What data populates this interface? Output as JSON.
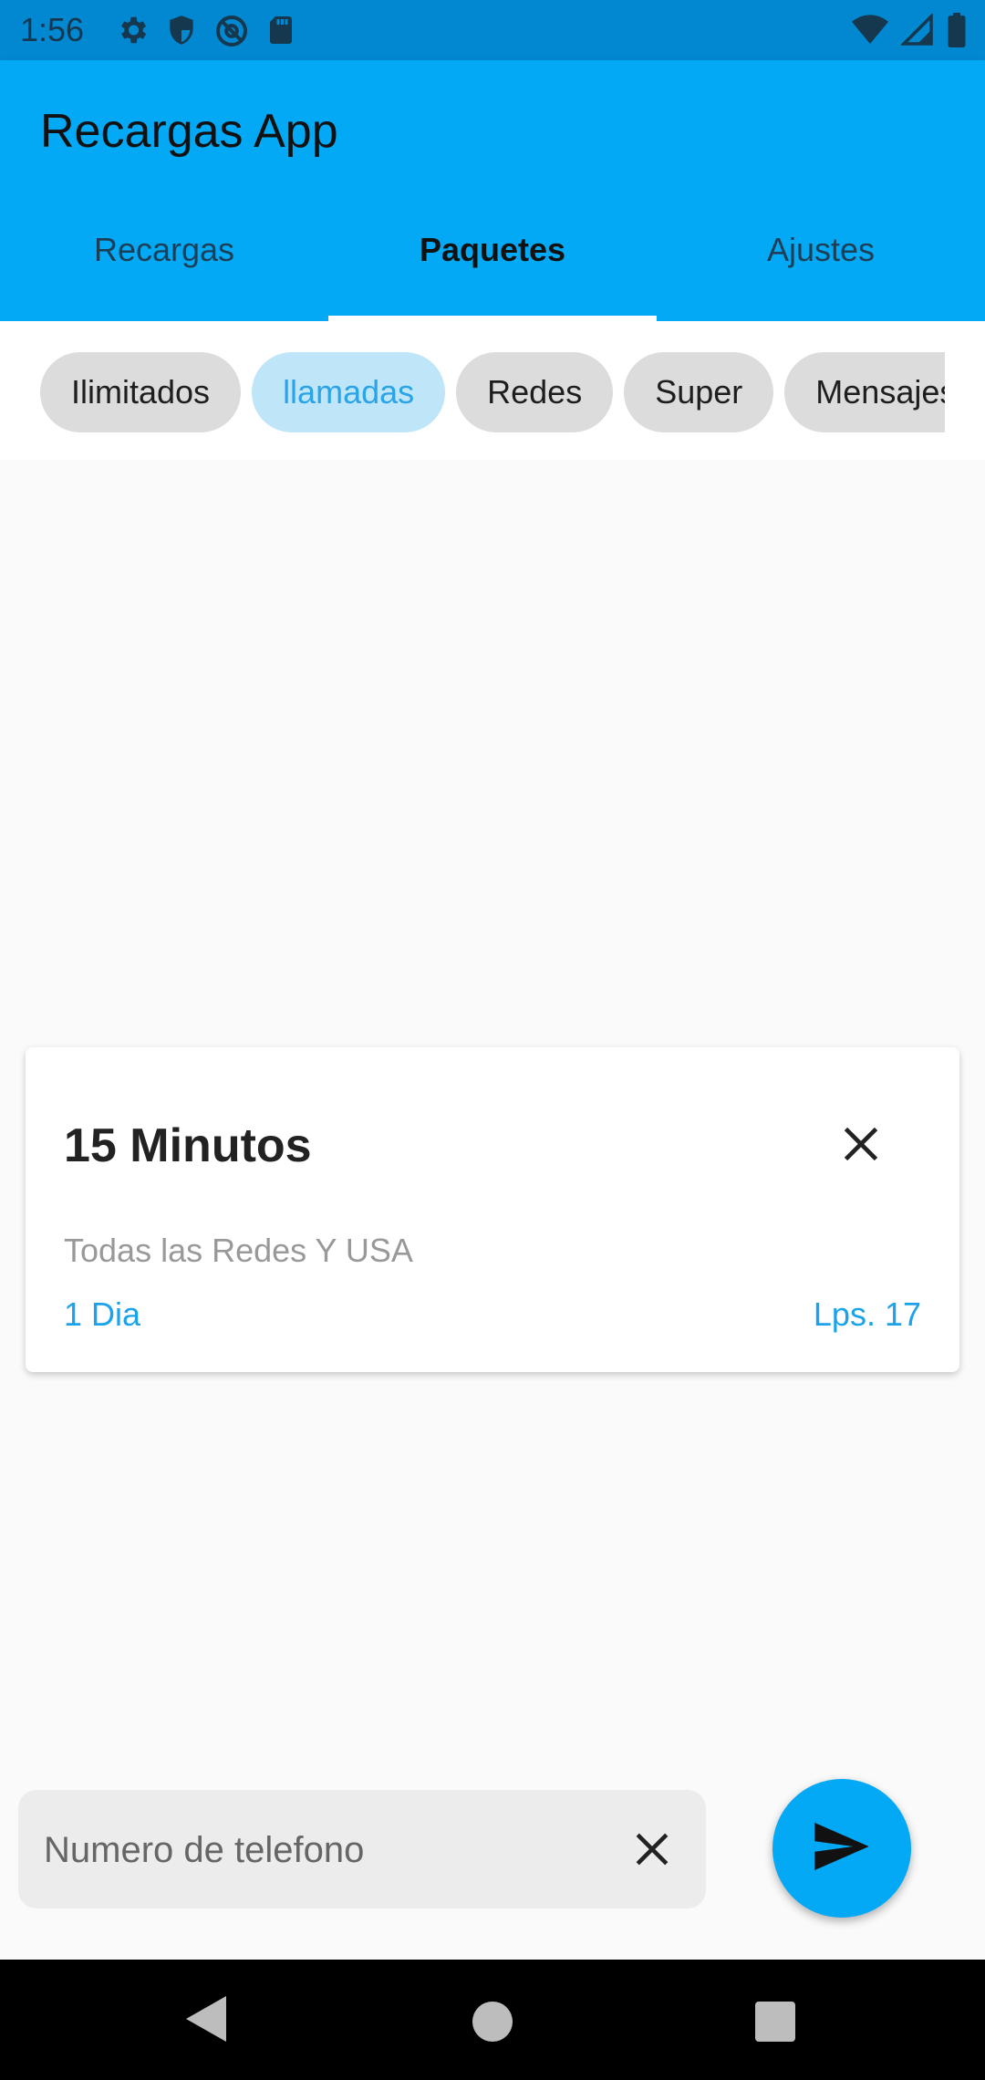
{
  "status_bar": {
    "time": "1:56",
    "left_icons": [
      "gear-icon",
      "shield-icon",
      "at-sign-icon",
      "sd-card-icon"
    ],
    "right_icons": [
      "wifi-icon",
      "signal-icon",
      "battery-icon"
    ]
  },
  "app_bar": {
    "title": "Recargas App",
    "tabs": [
      {
        "label": "Recargas",
        "active": false
      },
      {
        "label": "Paquetes",
        "active": true
      },
      {
        "label": "Ajustes",
        "active": false
      }
    ]
  },
  "chips": [
    {
      "label": "Ilimitados",
      "selected": false
    },
    {
      "label": "llamadas",
      "selected": true
    },
    {
      "label": "Redes",
      "selected": false
    },
    {
      "label": "Super",
      "selected": false
    },
    {
      "label": "Mensajes",
      "selected": false
    }
  ],
  "package_card": {
    "title": "15 Minutos",
    "description": "Todas las Redes Y USA",
    "duration": "1 Dia",
    "price": "Lps. 17"
  },
  "phone_field": {
    "placeholder": "Numero de telefono",
    "value": ""
  },
  "colors": {
    "primary": "#03a9f4",
    "status_bar": "#0288d1",
    "chip_selected_bg": "#bfe6f8",
    "accent_text": "#1aa3ea"
  }
}
